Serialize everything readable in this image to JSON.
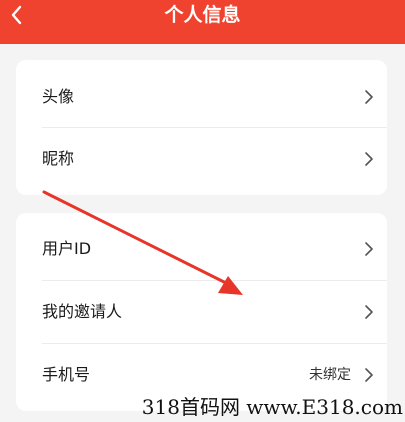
{
  "header": {
    "title": "个人信息",
    "back_icon": "chevron-left-icon",
    "background": "#f0432f"
  },
  "group1": {
    "items": [
      {
        "label": "头像",
        "value": ""
      },
      {
        "label": "昵称",
        "value": ""
      }
    ]
  },
  "group2": {
    "items": [
      {
        "label": "用户ID",
        "value": ""
      },
      {
        "label": "我的邀请人",
        "value": ""
      },
      {
        "label": "手机号",
        "value": "未绑定"
      }
    ]
  },
  "annotation": {
    "icon": "red-arrow-icon",
    "color": "#e8352a"
  },
  "watermark": {
    "text": "318首码网 www.E318.com"
  }
}
